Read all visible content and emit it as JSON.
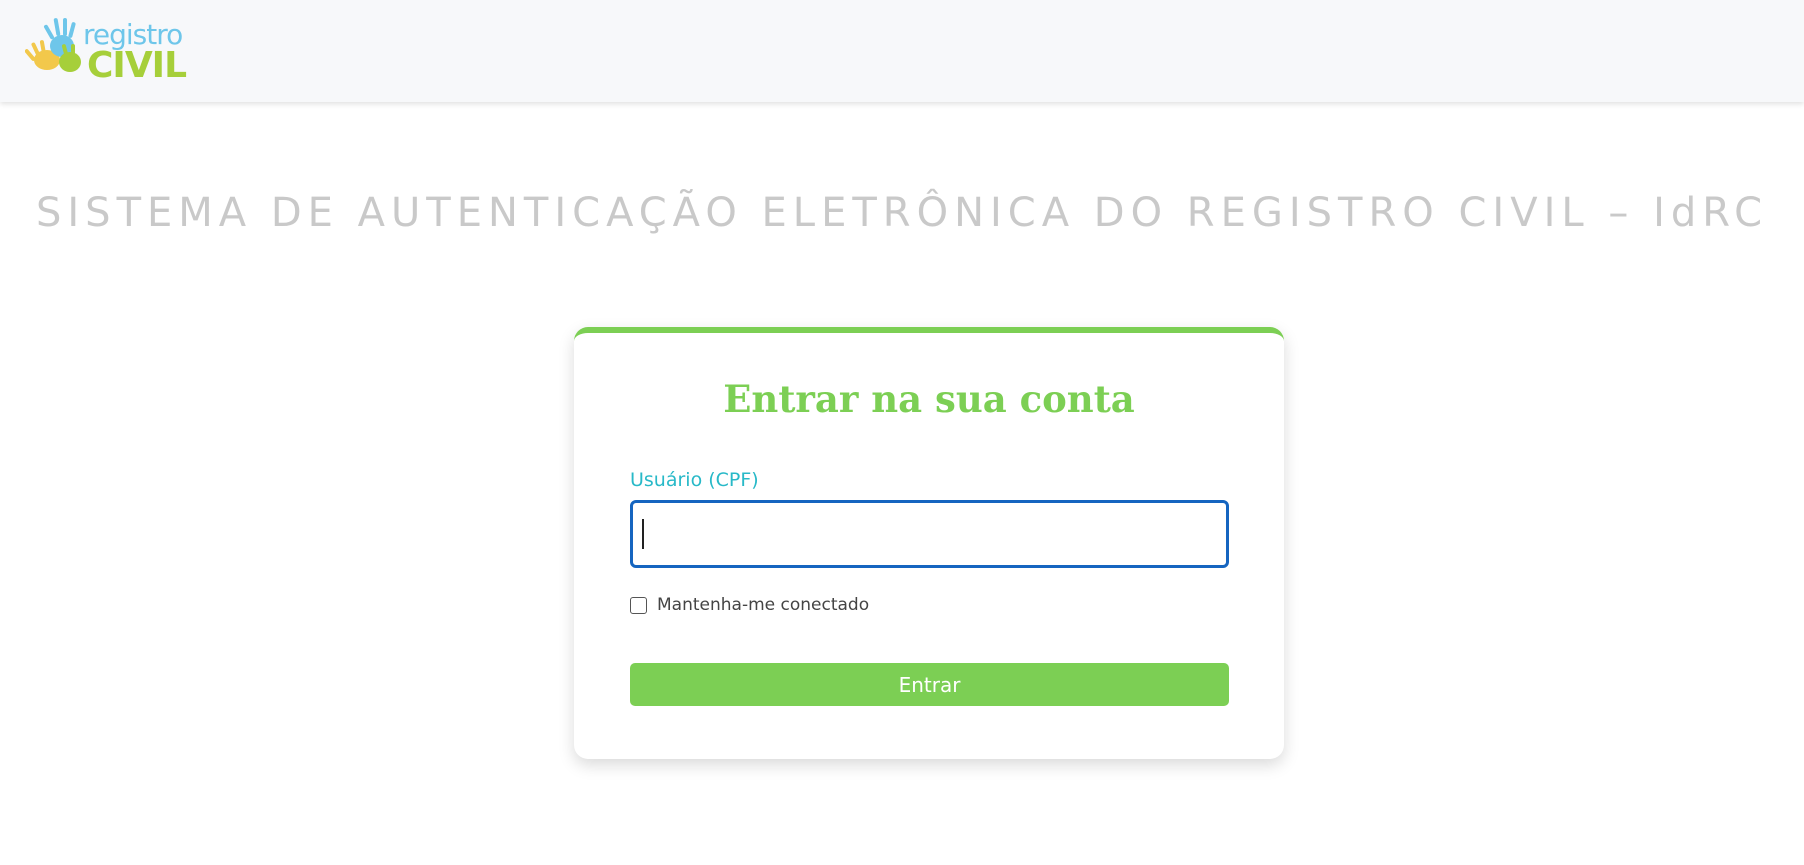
{
  "header": {
    "logo": {
      "text_top": "registro",
      "text_bottom": "CIVIL"
    }
  },
  "page": {
    "heading": "SISTEMA DE AUTENTICAÇÃO ELETRÔNICA DO REGISTRO CIVIL – IdRC"
  },
  "login": {
    "title": "Entrar na sua conta",
    "username_label": "Usuário (CPF)",
    "username_value": "",
    "remember_label": "Mantenha-me conectado",
    "remember_checked": false,
    "submit_label": "Entrar"
  },
  "colors": {
    "accent_green": "#7ccf54",
    "label_teal": "#28b9c8",
    "focus_blue": "#1565c0",
    "heading_gray": "#c9c9c9"
  }
}
